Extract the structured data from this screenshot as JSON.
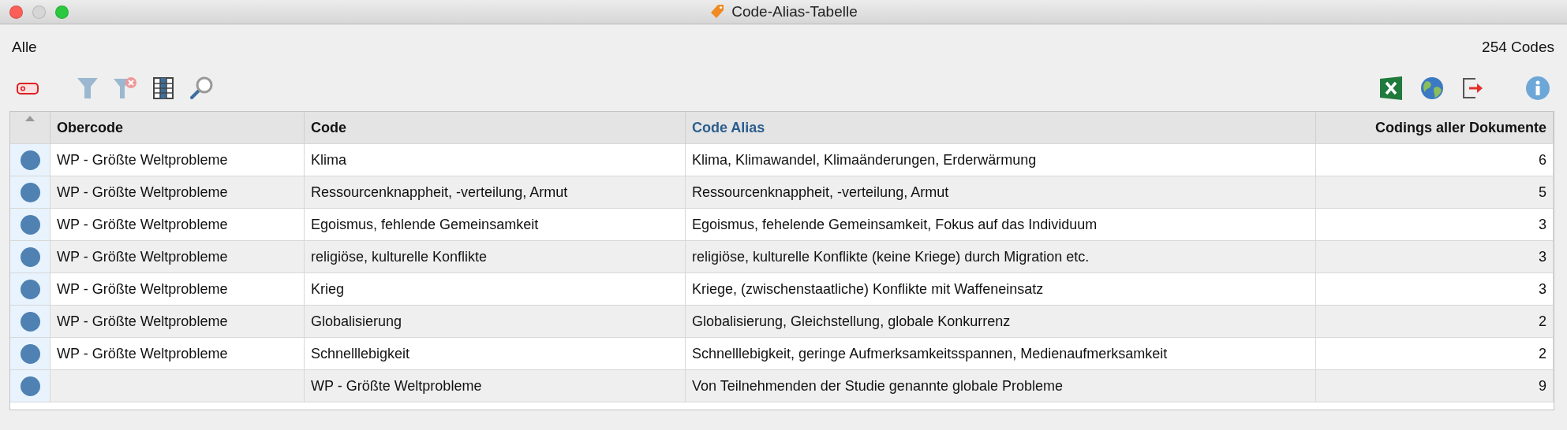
{
  "window": {
    "title": "Code-Alias-Tabelle"
  },
  "filter_label": "Alle",
  "count": "254 Codes",
  "table": {
    "columns": [
      {
        "label": "Obercode",
        "selected": false
      },
      {
        "label": "Code",
        "selected": false
      },
      {
        "label": "Code Alias",
        "selected": true
      },
      {
        "label": "Codings aller Dokumente",
        "selected": false
      }
    ],
    "rows": [
      {
        "obercode": "WP - Größte Weltprobleme",
        "code": "Klima",
        "alias": "Klima, Klimawandel, Klimaänderungen, Erderwärmung",
        "codings": "6"
      },
      {
        "obercode": "WP - Größte Weltprobleme",
        "code": "Ressourcenknappheit, -verteilung, Armut",
        "alias": "Ressourcenknappheit, -verteilung, Armut",
        "codings": "5"
      },
      {
        "obercode": "WP - Größte Weltprobleme",
        "code": "Egoismus, fehlende Gemeinsamkeit",
        "alias": "Egoismus, fehelende Gemeinsamkeit, Fokus auf das Individuum",
        "codings": "3"
      },
      {
        "obercode": "WP - Größte Weltprobleme",
        "code": "religiöse, kulturelle Konflikte",
        "alias": "religiöse, kulturelle Konflikte (keine Kriege) durch Migration etc.",
        "codings": "3"
      },
      {
        "obercode": "WP - Größte Weltprobleme",
        "code": "Krieg",
        "alias": "Kriege, (zwischenstaatliche) Konflikte mit Waffeneinsatz",
        "codings": "3"
      },
      {
        "obercode": "WP - Größte Weltprobleme",
        "code": "Globalisierung",
        "alias": "Globalisierung, Gleichstellung, globale Konkurrenz",
        "codings": "2"
      },
      {
        "obercode": "WP - Größte Weltprobleme",
        "code": "Schnelllebigkeit",
        "alias": "Schnelllebigkeit, geringe Aufmerksamkeitsspannen, Medienaufmerksamkeit",
        "codings": "2"
      },
      {
        "code": "WP - Größte Weltprobleme",
        "alias": "Von Teilnehmenden der Studie genannte globale Probleme",
        "codings": "9"
      }
    ]
  }
}
